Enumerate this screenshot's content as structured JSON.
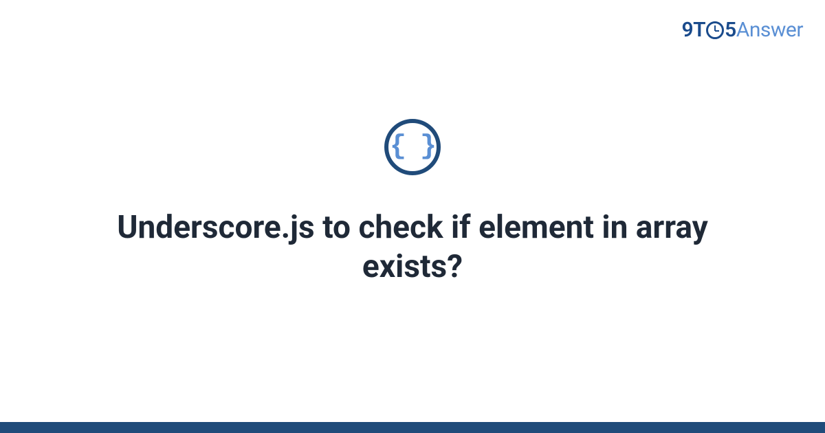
{
  "logo": {
    "part1": "9T",
    "part2": "5",
    "part3": "Answer"
  },
  "icon": {
    "glyph": "{ }",
    "name": "code-braces-icon"
  },
  "title": "Underscore.js to check if element in array exists?",
  "colors": {
    "accent_dark": "#204b7a",
    "accent_light": "#5a8fd4",
    "text": "#1f2937"
  }
}
